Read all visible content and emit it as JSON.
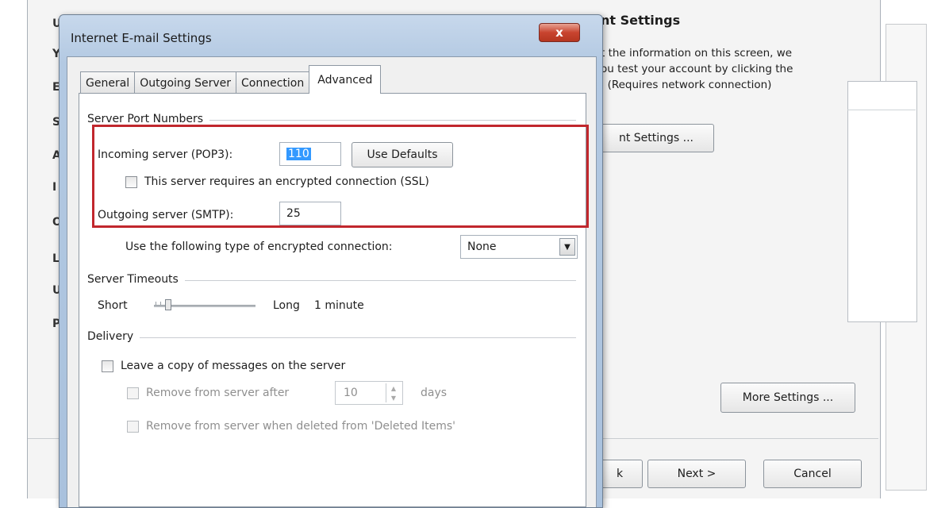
{
  "background": {
    "heading": "nt Settings",
    "info_text": "t the information on this screen, we\nou test your account by clicking the\n. (Requires network connection)",
    "test_settings_button": "nt Settings ...",
    "more_settings_button": "More Settings ...",
    "back_button": "k",
    "next_button": "Next >",
    "cancel_button": "Cancel",
    "edge_letters": [
      "U",
      "Y",
      "E",
      "S",
      "A",
      "I",
      "O",
      "L",
      "U",
      "P"
    ]
  },
  "dialog": {
    "title": "Internet E-mail Settings",
    "close_glyph": "x",
    "tabs": [
      {
        "label": "General",
        "active": false
      },
      {
        "label": "Outgoing Server",
        "active": false
      },
      {
        "label": "Connection",
        "active": false
      },
      {
        "label": "Advanced",
        "active": true
      }
    ],
    "server_ports": {
      "group_label": "Server Port Numbers",
      "incoming_label": "Incoming server (POP3):",
      "incoming_value": "110",
      "use_defaults_button": "Use Defaults",
      "ssl_checkbox_label": "This server requires an encrypted connection (SSL)",
      "ssl_checked": false,
      "outgoing_label": "Outgoing server (SMTP):",
      "outgoing_value": "25",
      "encryption_label": "Use the following type of encrypted connection:",
      "encryption_value": "None",
      "dropdown_glyph": "▼"
    },
    "timeouts": {
      "group_label": "Server Timeouts",
      "short_label": "Short",
      "long_label": "Long",
      "value_label": "1 minute"
    },
    "delivery": {
      "group_label": "Delivery",
      "leave_copy_label": "Leave a copy of messages on the server",
      "leave_copy_checked": false,
      "remove_after_label": "Remove from server after",
      "remove_after_value": "10",
      "days_label": "days",
      "remove_deleted_label": "Remove from server when deleted from 'Deleted Items'",
      "spin_up_glyph": "▲",
      "spin_down_glyph": "▼"
    }
  },
  "colors": {
    "highlight": "#c1272d",
    "selection": "#3399ff",
    "close_button": "#c8442f",
    "title_bar": "#b3c9e2"
  }
}
